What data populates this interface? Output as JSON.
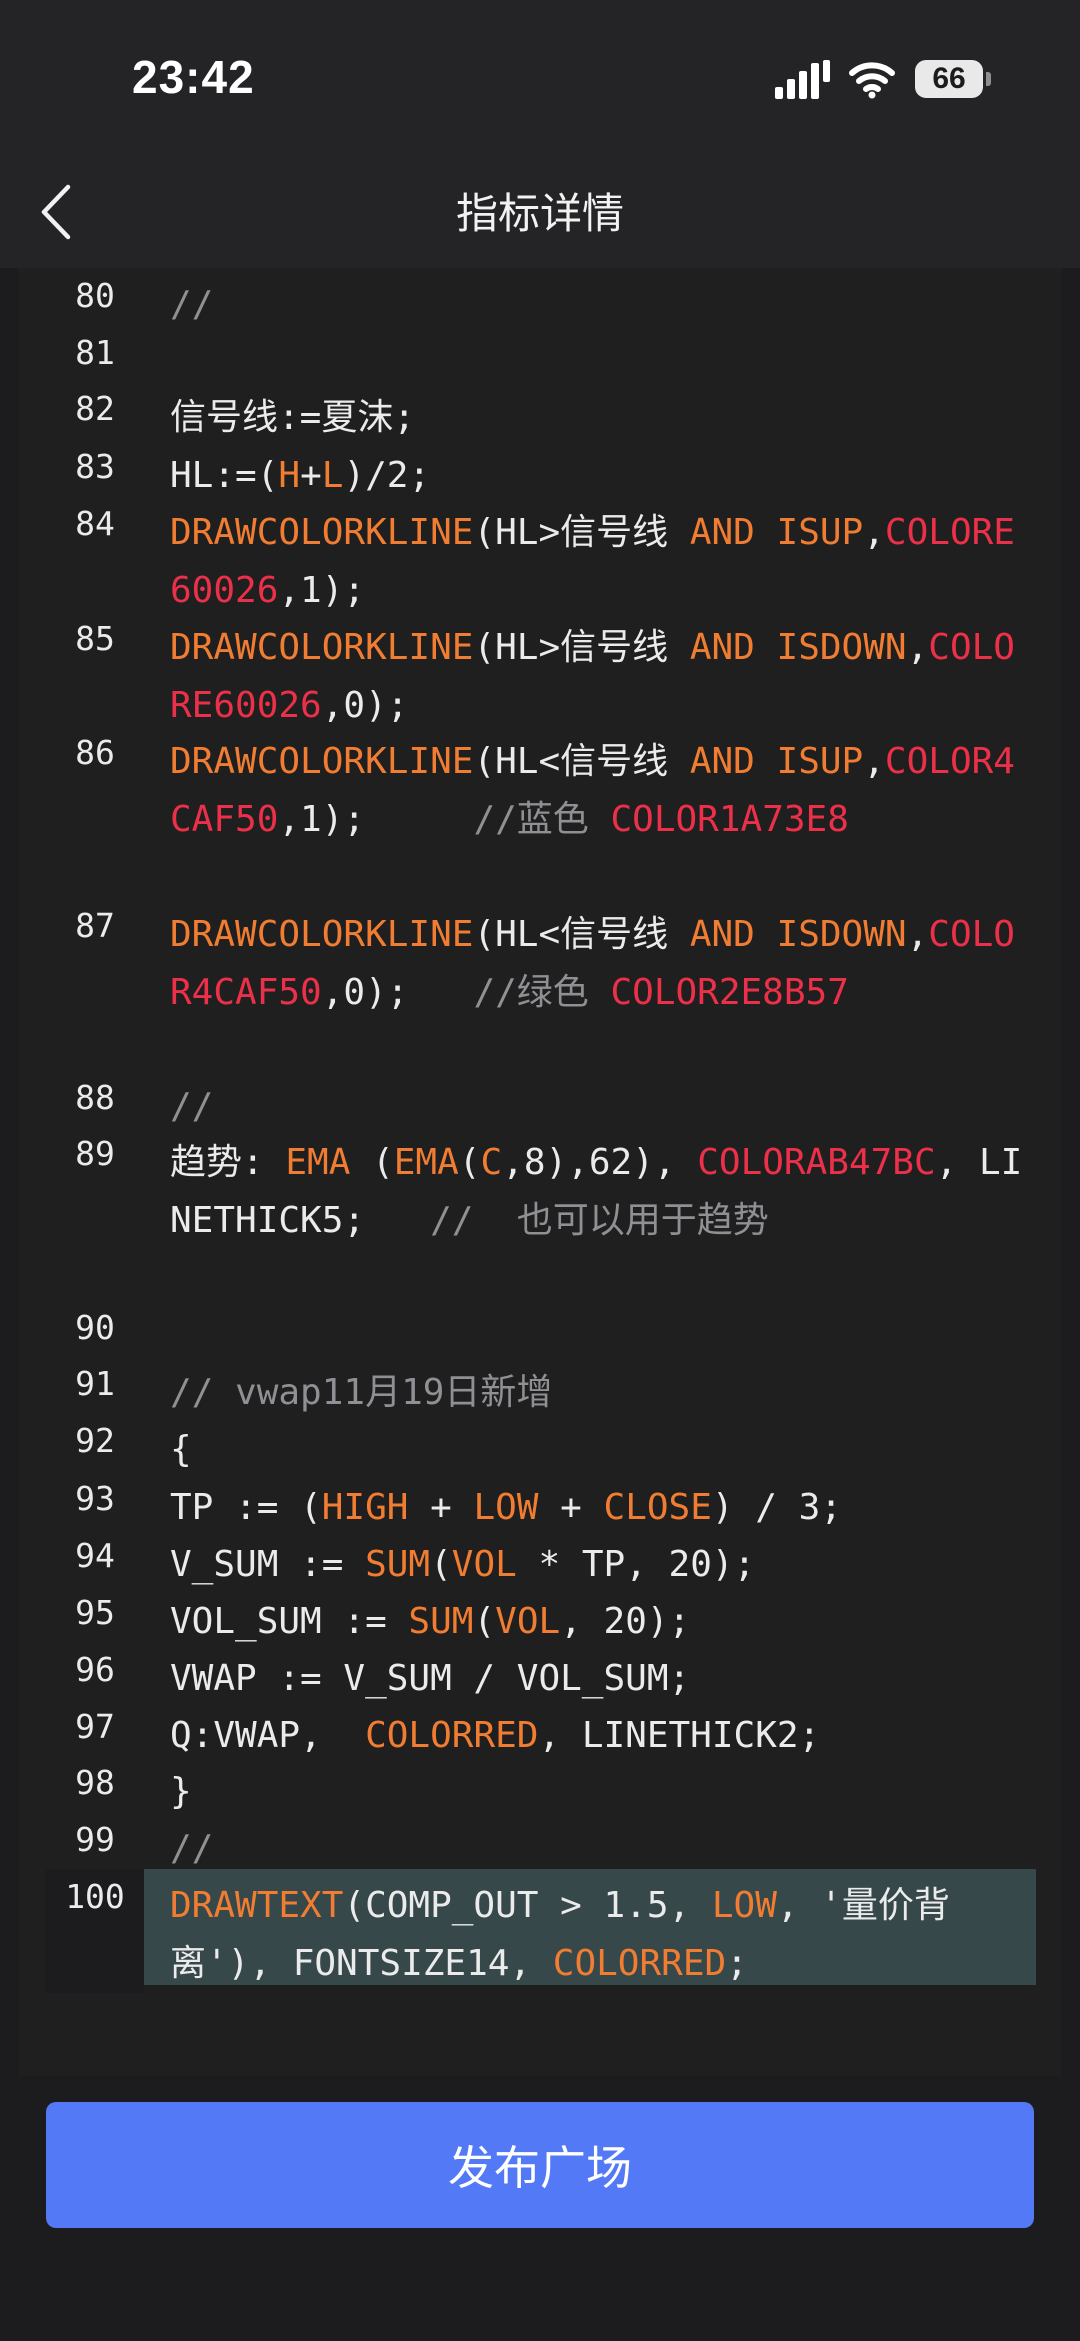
{
  "status_bar": {
    "time": "23:42",
    "battery": "66",
    "icons": [
      "cellular-signal-icon",
      "wifi-icon",
      "battery-icon"
    ]
  },
  "nav": {
    "title": "指标详情",
    "back_icon": "chevron-left-icon"
  },
  "colors": {
    "keyword": "#f07d32",
    "color_constant": "#ec3049",
    "comment": "#8f8f94",
    "text": "#ebebeb",
    "highlight_bg": "#36484a",
    "primary_button": "#5379f6"
  },
  "code_lines": [
    {
      "num": "80",
      "parts": [
        {
          "t": "//",
          "c": "comment"
        }
      ]
    },
    {
      "num": "81",
      "parts": []
    },
    {
      "num": "82",
      "parts": [
        {
          "t": "信号线:=夏沫;",
          "c": "text"
        }
      ]
    },
    {
      "num": "83",
      "parts": [
        {
          "t": "HL:=(",
          "c": "text"
        },
        {
          "t": "H",
          "c": "keyword"
        },
        {
          "t": "+",
          "c": "text"
        },
        {
          "t": "L",
          "c": "keyword"
        },
        {
          "t": ")/2;",
          "c": "text"
        }
      ]
    },
    {
      "num": "84",
      "parts": [
        {
          "t": "DRAWCOLORKLINE",
          "c": "keyword"
        },
        {
          "t": "(HL>信号线 ",
          "c": "text"
        },
        {
          "t": "AND",
          "c": "keyword"
        },
        {
          "t": " ",
          "c": "text"
        },
        {
          "t": "ISUP",
          "c": "keyword"
        },
        {
          "t": ",",
          "c": "text"
        },
        {
          "t": "COLORE60026",
          "c": "color_constant"
        },
        {
          "t": ",1);",
          "c": "text"
        }
      ]
    },
    {
      "num": "85",
      "parts": [
        {
          "t": "DRAWCOLORKLINE",
          "c": "keyword"
        },
        {
          "t": "(HL>信号线 ",
          "c": "text"
        },
        {
          "t": "AND",
          "c": "keyword"
        },
        {
          "t": " ",
          "c": "text"
        },
        {
          "t": "ISDOWN",
          "c": "keyword"
        },
        {
          "t": ",",
          "c": "text"
        },
        {
          "t": "COLORE60026",
          "c": "color_constant"
        },
        {
          "t": ",0);",
          "c": "text"
        }
      ]
    },
    {
      "num": "86",
      "parts": [
        {
          "t": "DRAWCOLORKLINE",
          "c": "keyword"
        },
        {
          "t": "(HL<信号线 ",
          "c": "text"
        },
        {
          "t": "AND",
          "c": "keyword"
        },
        {
          "t": " ",
          "c": "text"
        },
        {
          "t": "ISUP",
          "c": "keyword"
        },
        {
          "t": ",",
          "c": "text"
        },
        {
          "t": "COLOR4CAF50",
          "c": "color_constant"
        },
        {
          "t": ",1);     ",
          "c": "text"
        },
        {
          "t": "//蓝色 ",
          "c": "comment"
        },
        {
          "t": "COLOR1A73E8",
          "c": "color_constant"
        }
      ]
    },
    {
      "num": "87",
      "parts": [
        {
          "t": "DRAWCOLORKLINE",
          "c": "keyword"
        },
        {
          "t": "(HL<信号线 ",
          "c": "text"
        },
        {
          "t": "AND",
          "c": "keyword"
        },
        {
          "t": " ",
          "c": "text"
        },
        {
          "t": "ISDOWN",
          "c": "keyword"
        },
        {
          "t": ",",
          "c": "text"
        },
        {
          "t": "COLOR4CAF50",
          "c": "color_constant"
        },
        {
          "t": ",0);   ",
          "c": "text"
        },
        {
          "t": "//绿色 ",
          "c": "comment"
        },
        {
          "t": "COLOR2E8B57",
          "c": "color_constant"
        }
      ]
    },
    {
      "num": "88",
      "parts": [
        {
          "t": "//",
          "c": "comment"
        }
      ]
    },
    {
      "num": "89",
      "parts": [
        {
          "t": "趋势: ",
          "c": "text"
        },
        {
          "t": "EMA",
          "c": "keyword"
        },
        {
          "t": " (",
          "c": "text"
        },
        {
          "t": "EMA",
          "c": "keyword"
        },
        {
          "t": "(",
          "c": "text"
        },
        {
          "t": "C",
          "c": "keyword"
        },
        {
          "t": ",8),62), ",
          "c": "text"
        },
        {
          "t": "COLORAB47BC",
          "c": "color_constant"
        },
        {
          "t": ", LINETHICK5;   ",
          "c": "text"
        },
        {
          "t": "//  也可以用于趋势",
          "c": "comment"
        }
      ]
    },
    {
      "num": "90",
      "parts": []
    },
    {
      "num": "91",
      "parts": [
        {
          "t": "// vwap11月19日新增",
          "c": "comment"
        }
      ]
    },
    {
      "num": "92",
      "parts": [
        {
          "t": "{",
          "c": "text"
        }
      ]
    },
    {
      "num": "93",
      "parts": [
        {
          "t": "TP := (",
          "c": "text"
        },
        {
          "t": "HIGH",
          "c": "keyword"
        },
        {
          "t": " + ",
          "c": "text"
        },
        {
          "t": "LOW",
          "c": "keyword"
        },
        {
          "t": " + ",
          "c": "text"
        },
        {
          "t": "CLOSE",
          "c": "keyword"
        },
        {
          "t": ") / 3;",
          "c": "text"
        }
      ]
    },
    {
      "num": "94",
      "parts": [
        {
          "t": "V_SUM := ",
          "c": "text"
        },
        {
          "t": "SUM",
          "c": "keyword"
        },
        {
          "t": "(",
          "c": "text"
        },
        {
          "t": "VOL",
          "c": "keyword"
        },
        {
          "t": " * TP, 20);",
          "c": "text"
        }
      ]
    },
    {
      "num": "95",
      "parts": [
        {
          "t": "VOL_SUM := ",
          "c": "text"
        },
        {
          "t": "SUM",
          "c": "keyword"
        },
        {
          "t": "(",
          "c": "text"
        },
        {
          "t": "VOL",
          "c": "keyword"
        },
        {
          "t": ", 20);",
          "c": "text"
        }
      ]
    },
    {
      "num": "96",
      "parts": [
        {
          "t": "VWAP := V_SUM / VOL_SUM;",
          "c": "text"
        }
      ]
    },
    {
      "num": "97",
      "parts": [
        {
          "t": "Q:VWAP,  ",
          "c": "text"
        },
        {
          "t": "COLORRED",
          "c": "keyword"
        },
        {
          "t": ", LINETHICK2;",
          "c": "text"
        }
      ]
    },
    {
      "num": "98",
      "parts": [
        {
          "t": "}",
          "c": "text"
        }
      ]
    },
    {
      "num": "99",
      "parts": [
        {
          "t": "//",
          "c": "comment"
        }
      ]
    },
    {
      "num": "100",
      "current": true,
      "parts": [
        {
          "t": "DRAWTEXT",
          "c": "keyword"
        },
        {
          "t": "(COMP_OUT > 1.5, ",
          "c": "text"
        },
        {
          "t": "LOW",
          "c": "keyword"
        },
        {
          "t": ", '量价背离'), FONTSIZE14, ",
          "c": "text"
        },
        {
          "t": "COLORRED",
          "c": "keyword"
        },
        {
          "t": ";",
          "c": "text"
        }
      ]
    }
  ],
  "footer": {
    "publish_label": "发布广场"
  }
}
